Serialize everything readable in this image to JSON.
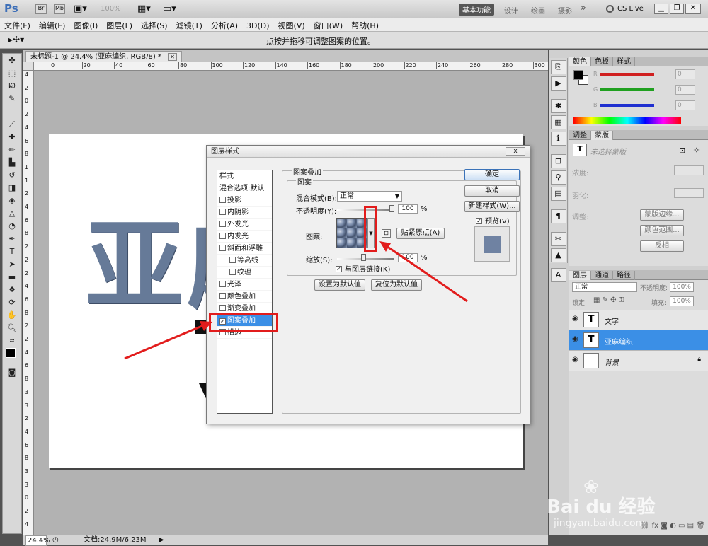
{
  "app": {
    "logo": "Ps",
    "zoom": "100%",
    "workspaces": [
      "基本功能",
      "设计",
      "绘画",
      "摄影"
    ],
    "more": "»",
    "cslive": "CS Live"
  },
  "menu": [
    "文件(F)",
    "编辑(E)",
    "图像(I)",
    "图层(L)",
    "选择(S)",
    "滤镜(T)",
    "分析(A)",
    "3D(D)",
    "视图(V)",
    "窗口(W)",
    "帮助(H)"
  ],
  "options_hint": "点按并拖移可调整图案的位置。",
  "document": {
    "tab_title": "未标题-1 @ 24.4% (亚麻编织, RGB/8) *",
    "ruler_h": [
      "0",
      "20",
      "40",
      "60",
      "80",
      "100",
      "120",
      "140",
      "160",
      "180",
      "200",
      "220",
      "240",
      "260",
      "280",
      "300"
    ],
    "ruler_v": [
      "4",
      "2",
      "0",
      "2",
      "4",
      "6",
      "8",
      "1",
      "1",
      "2",
      "4",
      "6",
      "8",
      "2",
      "2",
      "2",
      "4",
      "6",
      "8",
      "2",
      "2",
      "4",
      "6",
      "8",
      "3",
      "3",
      "2",
      "4",
      "6",
      "8",
      "3",
      "3",
      "0",
      "2",
      "4"
    ],
    "canvas_text": "亚麻"
  },
  "status": {
    "zoom": "24.4%",
    "doc_info": "文档:24.9M/6.23M"
  },
  "dialog": {
    "title": "图层样式",
    "close": "x",
    "styles_header": "样式",
    "blend_default": "混合选项:默认",
    "style_items": [
      {
        "label": "投影",
        "checked": false
      },
      {
        "label": "内阴影",
        "checked": false
      },
      {
        "label": "外发光",
        "checked": false
      },
      {
        "label": "内发光",
        "checked": false
      },
      {
        "label": "斜面和浮雕",
        "checked": false
      },
      {
        "label": "等高线",
        "checked": false
      },
      {
        "label": "纹理",
        "checked": false
      },
      {
        "label": "光泽",
        "checked": false
      },
      {
        "label": "颜色叠加",
        "checked": false
      },
      {
        "label": "渐变叠加",
        "checked": false
      },
      {
        "label": "图案叠加",
        "checked": true
      },
      {
        "label": "描边",
        "checked": false
      }
    ],
    "section_title": "图案叠加",
    "subsection": "图案",
    "blend_mode_label": "混合模式(B):",
    "blend_mode_value": "正常",
    "opacity_label": "不透明度(Y):",
    "opacity_value": "100",
    "opacity_unit": "%",
    "pattern_label": "图案:",
    "snap_origin": "贴紧原点(A)",
    "scale_label": "缩放(S):",
    "scale_value": "100",
    "scale_unit": "%",
    "link_layer": "与图层链接(K)",
    "link_checked": true,
    "set_default": "设置为默认值",
    "reset_default": "复位为默认值",
    "ok": "确定",
    "cancel": "取消",
    "new_style": "新建样式(W)...",
    "preview": "预览(V)",
    "preview_checked": true
  },
  "panels": {
    "color_tabs": [
      "颜色",
      "色板",
      "样式"
    ],
    "color_channels": [
      {
        "label": "R",
        "value": "0",
        "color": "#d02020"
      },
      {
        "label": "G",
        "value": "0",
        "color": "#20a020"
      },
      {
        "label": "B",
        "value": "0",
        "color": "#2030d0"
      }
    ],
    "adjust_tabs": [
      "调整",
      "蒙版"
    ],
    "mask_title": "未选择蒙版",
    "density_label": "浓度:",
    "feather_label": "羽化:",
    "refine_label": "调整:",
    "mask_edge": "蒙版边缘...",
    "color_range": "颜色范围...",
    "invert": "反相",
    "layers_tabs": [
      "图层",
      "通道",
      "路径"
    ],
    "layer_blend": "正常",
    "layer_opacity_label": "不透明度:",
    "layer_opacity": "100%",
    "lock_label": "锁定:",
    "fill_label": "填充:",
    "fill_value": "100%",
    "layers": [
      {
        "name": "文字",
        "type": "text",
        "selected": false
      },
      {
        "name": "亚麻编织",
        "type": "text",
        "selected": true
      },
      {
        "name": "背景",
        "type": "bg",
        "selected": false
      }
    ]
  },
  "colors": {
    "accent": "#3b8fe6",
    "annotation": "#e21c1c",
    "selected_layer": "#3b8fe6"
  },
  "watermark": {
    "brand": "Bai du 经验",
    "url": "jingyan.baidu.com"
  }
}
